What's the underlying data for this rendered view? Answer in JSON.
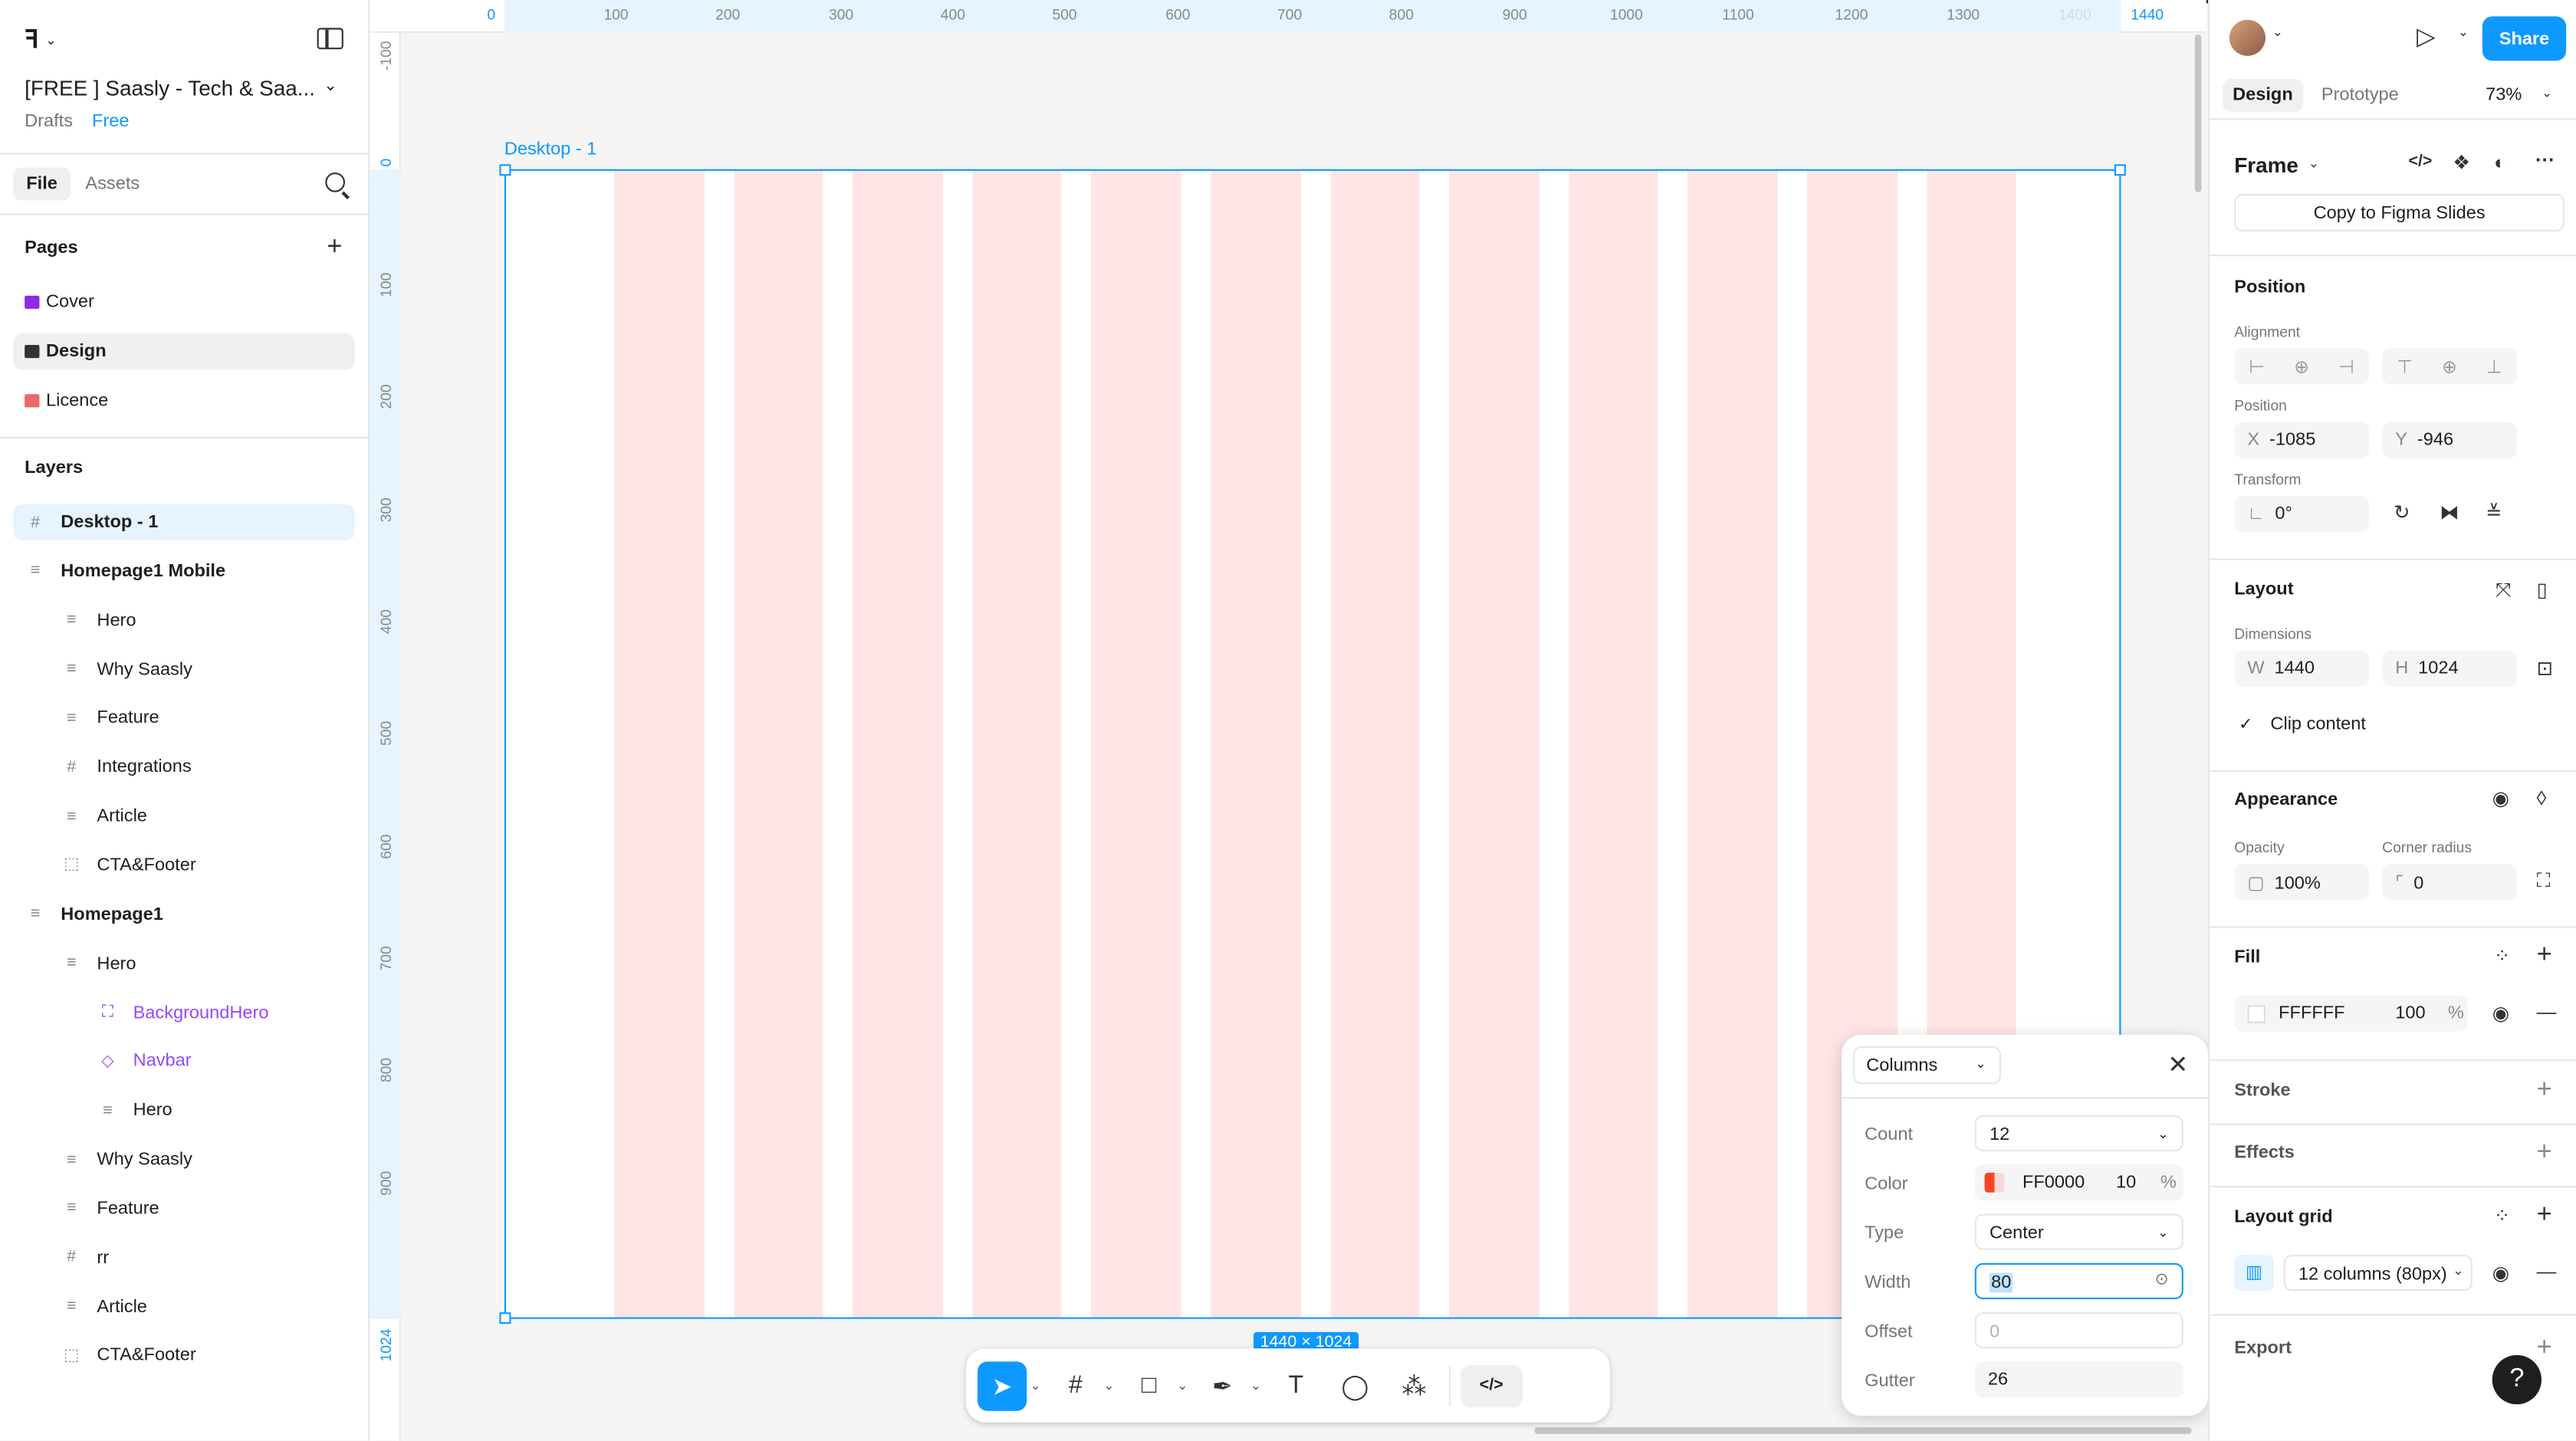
{
  "header": {
    "file_title": "[FREE ] Saasly - Tech & Saa...",
    "drafts": "Drafts",
    "plan": "Free"
  },
  "left_tabs": {
    "file": "File",
    "assets": "Assets"
  },
  "pages": {
    "title": "Pages",
    "items": [
      {
        "label": "Cover",
        "color": "#8a2be2"
      },
      {
        "label": "Design",
        "color": "#333333"
      },
      {
        "label": "Licence",
        "color": "#e66"
      }
    ]
  },
  "layers": {
    "title": "Layers",
    "items": [
      {
        "label": "Desktop - 1",
        "icon": "frame-icon",
        "glyph": "#"
      },
      {
        "label": "Homepage1 Mobile",
        "icon": "autolayout-icon",
        "glyph": "≡"
      },
      {
        "label": "Hero",
        "icon": "autolayout-icon",
        "glyph": "≡"
      },
      {
        "label": "Why Saasly",
        "icon": "autolayout-icon",
        "glyph": "≡"
      },
      {
        "label": "Feature",
        "icon": "autolayout-icon",
        "glyph": "≡"
      },
      {
        "label": "Integrations",
        "icon": "frame-icon",
        "glyph": "#"
      },
      {
        "label": "Article",
        "icon": "autolayout-icon",
        "glyph": "≡"
      },
      {
        "label": "CTA&Footer",
        "icon": "section-icon",
        "glyph": "⬚"
      },
      {
        "label": "Homepage1",
        "icon": "autolayout-icon",
        "glyph": "≡"
      },
      {
        "label": "Hero",
        "icon": "autolayout-icon",
        "glyph": "≡"
      },
      {
        "label": "BackgroundHero",
        "icon": "instance-icon",
        "glyph": "⛶"
      },
      {
        "label": "Navbar",
        "icon": "component-instance-icon",
        "glyph": "◇"
      },
      {
        "label": "Hero",
        "icon": "autolayout-icon",
        "glyph": "≡"
      },
      {
        "label": "Why Saasly",
        "icon": "autolayout-icon",
        "glyph": "≡"
      },
      {
        "label": "Feature",
        "icon": "autolayout-icon",
        "glyph": "≡"
      },
      {
        "label": "rr",
        "icon": "frame-icon",
        "glyph": "#"
      },
      {
        "label": "Article",
        "icon": "autolayout-icon",
        "glyph": "≡"
      },
      {
        "label": "CTA&Footer",
        "icon": "section-icon",
        "glyph": "⬚"
      }
    ]
  },
  "rulers": {
    "top": [
      "0",
      "100",
      "200",
      "300",
      "400",
      "500",
      "600",
      "700",
      "800",
      "900",
      "1000",
      "1100",
      "1200",
      "1300",
      "1400",
      "1440"
    ],
    "left": [
      "-100",
      "0",
      "100",
      "200",
      "300",
      "400",
      "500",
      "600",
      "700",
      "800",
      "900",
      "1024"
    ]
  },
  "canvas": {
    "frame_label": "Desktop - 1",
    "dims_badge": "1440 × 1024",
    "grid_columns": 12,
    "grid_color": "#FF0000"
  },
  "toolbar": {
    "move": "➤",
    "frame": "#",
    "shape": "□",
    "pen": "✒",
    "text": "T",
    "comment": "◯",
    "actions": "⁂",
    "dev": "</>"
  },
  "grid_popover": {
    "type_select": "Columns",
    "count_label": "Count",
    "count_value": "12",
    "color_label": "Color",
    "color_hex": "FF0000",
    "color_opacity": "10",
    "pct": "%",
    "type_label": "Type",
    "type_value": "Center",
    "width_label": "Width",
    "width_value": "80",
    "offset_label": "Offset",
    "offset_placeholder": "0",
    "gutter_label": "Gutter",
    "gutter_value": "26"
  },
  "right_panel": {
    "share": "Share",
    "tab_design": "Design",
    "tab_prototype": "Prototype",
    "zoom": "73%",
    "frame_type": "Frame",
    "copy_button": "Copy to Figma Slides",
    "position": {
      "title": "Position",
      "alignment_label": "Alignment",
      "position_label": "Position",
      "x_label": "X",
      "x": "-1085",
      "y_label": "Y",
      "y": "-946",
      "transform_label": "Transform",
      "rotation": "0°"
    },
    "layout": {
      "title": "Layout",
      "dimensions_label": "Dimensions",
      "w_label": "W",
      "w": "1440",
      "h_label": "H",
      "h": "1024",
      "clip_content": "Clip content"
    },
    "appearance": {
      "title": "Appearance",
      "opacity_label": "Opacity",
      "opacity": "100%",
      "radius_label": "Corner radius",
      "radius": "0"
    },
    "fill": {
      "title": "Fill",
      "hex": "FFFFFF",
      "opacity": "100",
      "pct": "%"
    },
    "stroke": {
      "title": "Stroke"
    },
    "effects": {
      "title": "Effects"
    },
    "layout_grid": {
      "title": "Layout grid",
      "value": "12 columns (80px)"
    },
    "export": {
      "title": "Export"
    },
    "help": "?"
  }
}
